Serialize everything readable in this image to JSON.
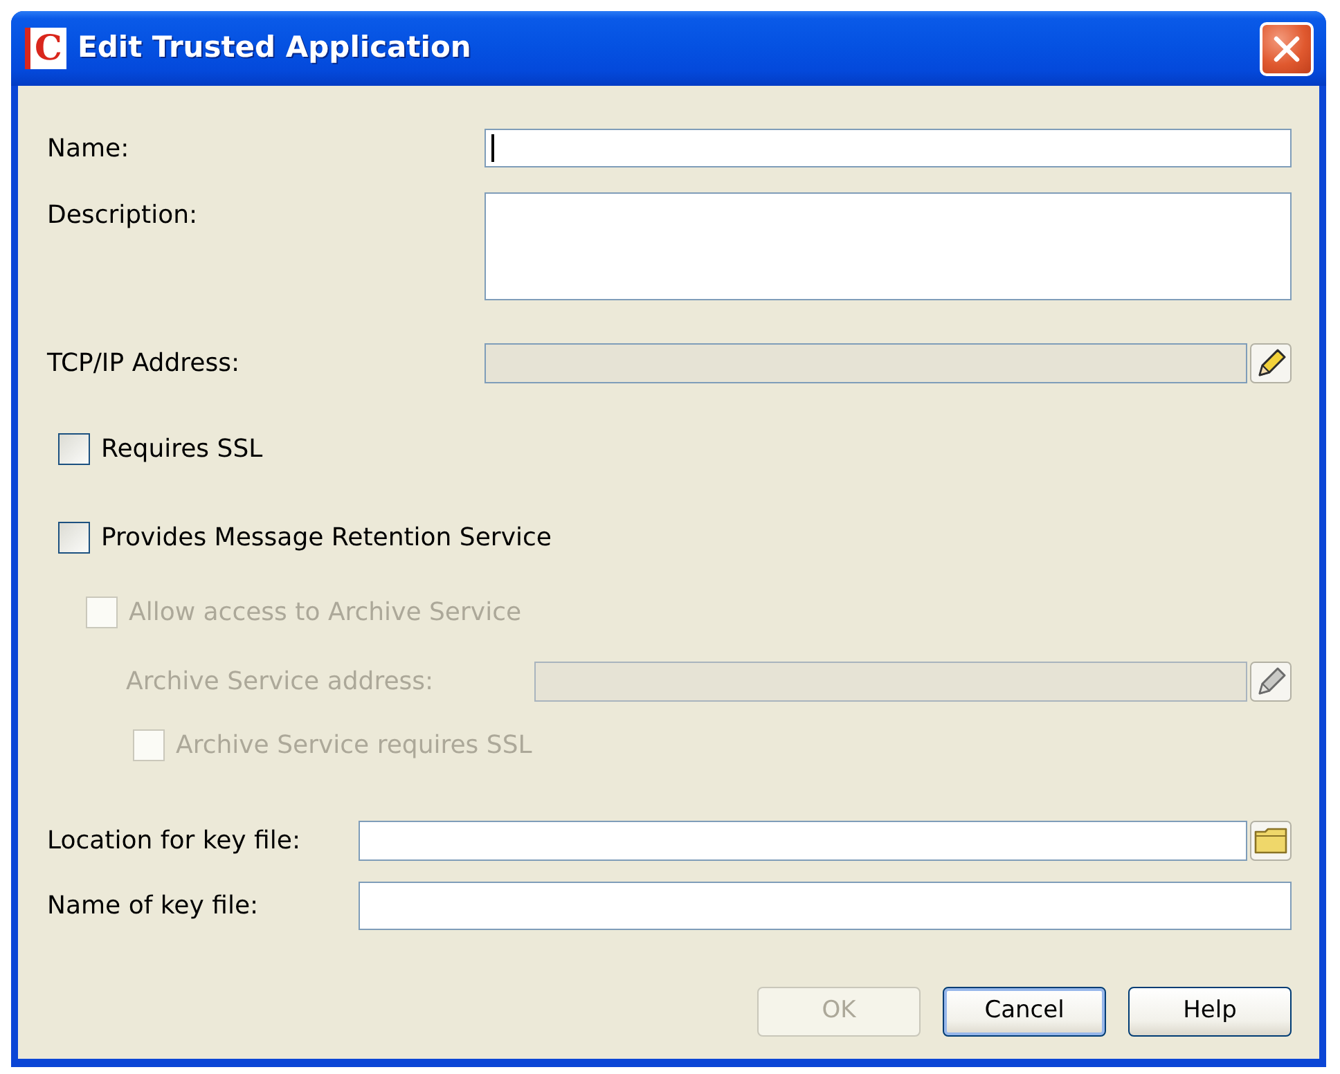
{
  "window": {
    "title": "Edit Trusted Application",
    "logo_letter": "C"
  },
  "fields": [
    {
      "kind": "text",
      "label": "Name:",
      "focused": true,
      "readonly": false
    },
    {
      "kind": "multiline",
      "label": "Description:",
      "focused": false,
      "readonly": false
    },
    {
      "kind": "edit",
      "label": "TCP/IP Address:",
      "focused": false,
      "readonly": true
    }
  ],
  "options": [
    {
      "kind": "checkbox",
      "label": "Requires SSL",
      "checked": false,
      "disabled": false
    },
    {
      "kind": "checkbox",
      "label": "Provides Message Retention Service",
      "checked": false,
      "disabled": false,
      "children": [
        {
          "kind": "checkbox",
          "label": "Allow access to Archive Service",
          "checked": false,
          "disabled": true,
          "children": [
            {
              "kind": "edit",
              "label": "Archive Service address:",
              "disabled": true
            },
            {
              "kind": "checkbox",
              "label": "Archive Service requires SSL",
              "checked": false,
              "disabled": true
            }
          ]
        }
      ]
    }
  ],
  "key_file": [
    {
      "kind": "browse",
      "label": "Location for key file:"
    },
    {
      "kind": "text",
      "label": "Name of key file:"
    }
  ],
  "buttons": [
    {
      "label": "OK",
      "disabled": true,
      "default": false
    },
    {
      "label": "Cancel",
      "disabled": false,
      "default": true
    },
    {
      "label": "Help",
      "disabled": false,
      "default": false
    }
  ]
}
